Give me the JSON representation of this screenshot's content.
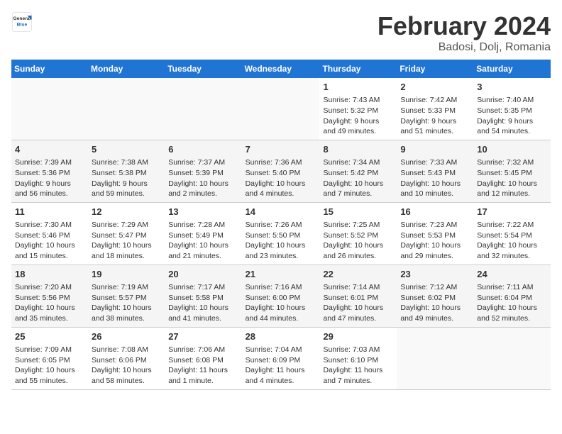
{
  "logo": {
    "general": "General",
    "blue": "Blue"
  },
  "title": "February 2024",
  "subtitle": "Badosi, Dolj, Romania",
  "days_header": [
    "Sunday",
    "Monday",
    "Tuesday",
    "Wednesday",
    "Thursday",
    "Friday",
    "Saturday"
  ],
  "weeks": [
    [
      {
        "num": "",
        "info": ""
      },
      {
        "num": "",
        "info": ""
      },
      {
        "num": "",
        "info": ""
      },
      {
        "num": "",
        "info": ""
      },
      {
        "num": "1",
        "info": "Sunrise: 7:43 AM\nSunset: 5:32 PM\nDaylight: 9 hours and 49 minutes."
      },
      {
        "num": "2",
        "info": "Sunrise: 7:42 AM\nSunset: 5:33 PM\nDaylight: 9 hours and 51 minutes."
      },
      {
        "num": "3",
        "info": "Sunrise: 7:40 AM\nSunset: 5:35 PM\nDaylight: 9 hours and 54 minutes."
      }
    ],
    [
      {
        "num": "4",
        "info": "Sunrise: 7:39 AM\nSunset: 5:36 PM\nDaylight: 9 hours and 56 minutes."
      },
      {
        "num": "5",
        "info": "Sunrise: 7:38 AM\nSunset: 5:38 PM\nDaylight: 9 hours and 59 minutes."
      },
      {
        "num": "6",
        "info": "Sunrise: 7:37 AM\nSunset: 5:39 PM\nDaylight: 10 hours and 2 minutes."
      },
      {
        "num": "7",
        "info": "Sunrise: 7:36 AM\nSunset: 5:40 PM\nDaylight: 10 hours and 4 minutes."
      },
      {
        "num": "8",
        "info": "Sunrise: 7:34 AM\nSunset: 5:42 PM\nDaylight: 10 hours and 7 minutes."
      },
      {
        "num": "9",
        "info": "Sunrise: 7:33 AM\nSunset: 5:43 PM\nDaylight: 10 hours and 10 minutes."
      },
      {
        "num": "10",
        "info": "Sunrise: 7:32 AM\nSunset: 5:45 PM\nDaylight: 10 hours and 12 minutes."
      }
    ],
    [
      {
        "num": "11",
        "info": "Sunrise: 7:30 AM\nSunset: 5:46 PM\nDaylight: 10 hours and 15 minutes."
      },
      {
        "num": "12",
        "info": "Sunrise: 7:29 AM\nSunset: 5:47 PM\nDaylight: 10 hours and 18 minutes."
      },
      {
        "num": "13",
        "info": "Sunrise: 7:28 AM\nSunset: 5:49 PM\nDaylight: 10 hours and 21 minutes."
      },
      {
        "num": "14",
        "info": "Sunrise: 7:26 AM\nSunset: 5:50 PM\nDaylight: 10 hours and 23 minutes."
      },
      {
        "num": "15",
        "info": "Sunrise: 7:25 AM\nSunset: 5:52 PM\nDaylight: 10 hours and 26 minutes."
      },
      {
        "num": "16",
        "info": "Sunrise: 7:23 AM\nSunset: 5:53 PM\nDaylight: 10 hours and 29 minutes."
      },
      {
        "num": "17",
        "info": "Sunrise: 7:22 AM\nSunset: 5:54 PM\nDaylight: 10 hours and 32 minutes."
      }
    ],
    [
      {
        "num": "18",
        "info": "Sunrise: 7:20 AM\nSunset: 5:56 PM\nDaylight: 10 hours and 35 minutes."
      },
      {
        "num": "19",
        "info": "Sunrise: 7:19 AM\nSunset: 5:57 PM\nDaylight: 10 hours and 38 minutes."
      },
      {
        "num": "20",
        "info": "Sunrise: 7:17 AM\nSunset: 5:58 PM\nDaylight: 10 hours and 41 minutes."
      },
      {
        "num": "21",
        "info": "Sunrise: 7:16 AM\nSunset: 6:00 PM\nDaylight: 10 hours and 44 minutes."
      },
      {
        "num": "22",
        "info": "Sunrise: 7:14 AM\nSunset: 6:01 PM\nDaylight: 10 hours and 47 minutes."
      },
      {
        "num": "23",
        "info": "Sunrise: 7:12 AM\nSunset: 6:02 PM\nDaylight: 10 hours and 49 minutes."
      },
      {
        "num": "24",
        "info": "Sunrise: 7:11 AM\nSunset: 6:04 PM\nDaylight: 10 hours and 52 minutes."
      }
    ],
    [
      {
        "num": "25",
        "info": "Sunrise: 7:09 AM\nSunset: 6:05 PM\nDaylight: 10 hours and 55 minutes."
      },
      {
        "num": "26",
        "info": "Sunrise: 7:08 AM\nSunset: 6:06 PM\nDaylight: 10 hours and 58 minutes."
      },
      {
        "num": "27",
        "info": "Sunrise: 7:06 AM\nSunset: 6:08 PM\nDaylight: 11 hours and 1 minute."
      },
      {
        "num": "28",
        "info": "Sunrise: 7:04 AM\nSunset: 6:09 PM\nDaylight: 11 hours and 4 minutes."
      },
      {
        "num": "29",
        "info": "Sunrise: 7:03 AM\nSunset: 6:10 PM\nDaylight: 11 hours and 7 minutes."
      },
      {
        "num": "",
        "info": ""
      },
      {
        "num": "",
        "info": ""
      }
    ]
  ]
}
